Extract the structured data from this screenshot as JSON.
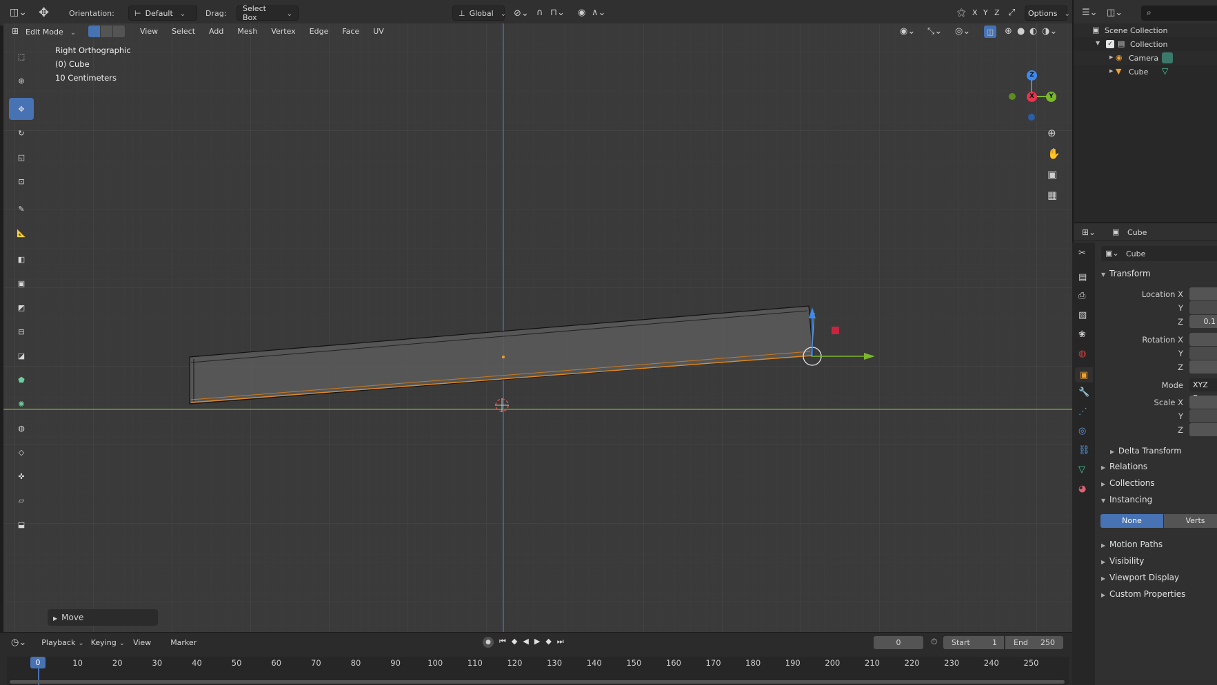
{
  "header": {
    "orientation_label": "Orientation:",
    "orientation_value": "Default",
    "drag_label": "Drag:",
    "drag_value": "Select Box",
    "transform_space": "Global",
    "axes": [
      "X",
      "Y",
      "Z"
    ],
    "options_label": "Options"
  },
  "viewport_header": {
    "mode": "Edit Mode",
    "menus": [
      "View",
      "Select",
      "Add",
      "Mesh",
      "Vertex",
      "Edge",
      "Face",
      "UV"
    ]
  },
  "viewport": {
    "view_name": "Right Orthographic",
    "object_label": "(0) Cube",
    "scale_label": "10 Centimeters",
    "gizmo_axes": {
      "z": "Z",
      "x": "X",
      "y": "Y"
    },
    "operator_panel": "Move"
  },
  "tools": [
    "select-box-tool",
    "cursor-tool",
    "move-tool",
    "rotate-tool",
    "scale-tool",
    "transform-tool",
    "annotate-tool",
    "measure-tool",
    "extrude-region-tool",
    "inset-faces-tool",
    "bevel-tool",
    "loop-cut-tool",
    "knife-tool",
    "poly-build-tool",
    "spin-tool",
    "smooth-tool",
    "edge-slide-tool",
    "shrink-fatten-tool",
    "shear-tool",
    "rip-region-tool"
  ],
  "active_tool": "move-tool",
  "outliner": {
    "root": "Scene Collection",
    "collection": "Collection",
    "items": [
      {
        "name": "Camera",
        "icon": "camera-icon",
        "data_icon": "camera-data-icon"
      },
      {
        "name": "Cube",
        "icon": "mesh-object-icon",
        "data_icon": "mesh-data-icon"
      }
    ]
  },
  "properties": {
    "header_object": "Cube",
    "object_name": "Cube",
    "sections": {
      "transform": "Transform",
      "location_x": "Location X",
      "y": "Y",
      "z": "Z",
      "location_z_value": "0.1",
      "rotation_x": "Rotation X",
      "mode_label": "Mode",
      "mode_value": "XYZ Eu",
      "scale_x": "Scale X",
      "delta_transform": "Delta Transform",
      "relations": "Relations",
      "collections": "Collections",
      "instancing": "Instancing",
      "instancing_none": "None",
      "instancing_verts": "Verts",
      "motion_paths": "Motion Paths",
      "visibility": "Visibility",
      "viewport_display": "Viewport Display",
      "custom_properties": "Custom Properties"
    }
  },
  "timeline": {
    "menus": [
      "Playback",
      "Keying",
      "View",
      "Marker"
    ],
    "current_frame": "0",
    "start_label": "Start",
    "start_value": "1",
    "end_label": "End",
    "end_value": "250",
    "ruler_ticks": [
      "0",
      "10",
      "20",
      "30",
      "40",
      "50",
      "60",
      "70",
      "80",
      "90",
      "100",
      "110",
      "120",
      "130",
      "140",
      "150",
      "160",
      "170",
      "180",
      "190",
      "200",
      "210",
      "220",
      "230",
      "240",
      "250"
    ]
  },
  "colors": {
    "accent": "#4772b3",
    "x_axis": "#e8334f",
    "y_axis": "#7ab82a",
    "z_axis": "#3b8cf0",
    "selected": "#f0a030"
  }
}
